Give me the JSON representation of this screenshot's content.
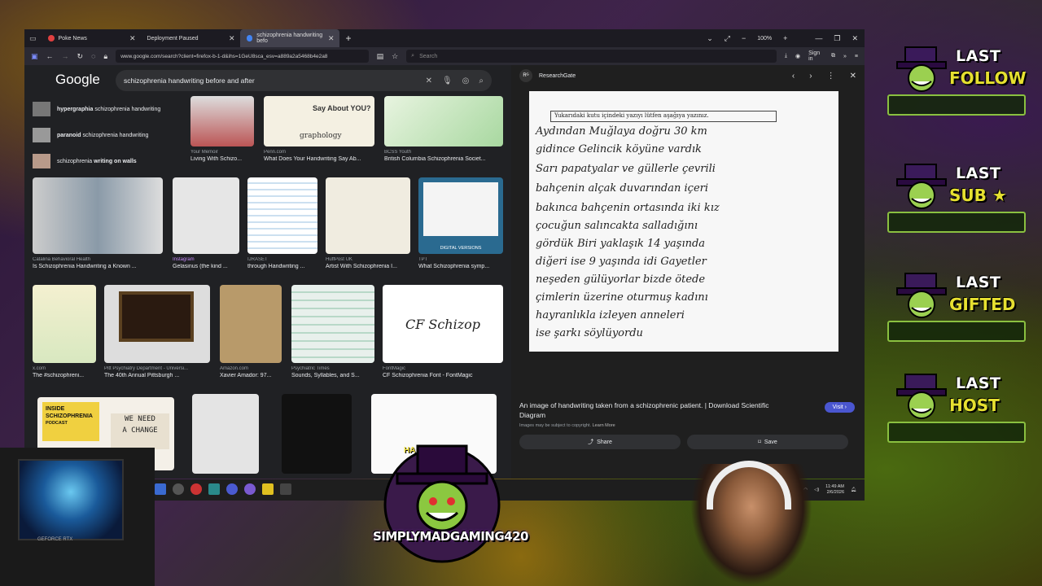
{
  "browser": {
    "tabs": [
      {
        "label": "Poke News",
        "active": false
      },
      {
        "label": "Deployment Paused",
        "active": false
      },
      {
        "label": "schizophrenia handwriting befo",
        "active": true
      }
    ],
    "zoom": "100%",
    "url": "www.google.com/search?client=firefox-b-1-d&ihs=1GeU8sca_esv=a889a2a5468b4e2a8",
    "search_placeholder": "Search",
    "sign_in": "Sign in"
  },
  "google": {
    "logo": "Google",
    "query": "schizophrenia handwriting before and after",
    "suggestions": [
      {
        "bold": "hypergraphia",
        "rest": "schizophrenia handwriting"
      },
      {
        "bold": "paranoid",
        "rest": "schizophrenia handwriting"
      },
      {
        "rest": "schizophrenia",
        "bold": "writing on walls"
      }
    ],
    "results_row1": [
      {
        "source": "Your Memoir",
        "title": "Living With Schizo..."
      },
      {
        "source": "Penn.com",
        "title": "What Does Your Handwriting Say Ab..."
      },
      {
        "source": "BCSS Youth",
        "title": "British Columbia Schizophrenia Societ..."
      }
    ],
    "results_row2": [
      {
        "source": "Catalina Behavioral Health",
        "title": "Is Schizophrenia Handwriting a Known ..."
      },
      {
        "source": "Instagram",
        "title": "Gelasinus (the kind ..."
      },
      {
        "source": "IJRASET",
        "title": "through Handwriting ..."
      },
      {
        "source": "HuffPost UK",
        "title": "Artist With Schizophrenia I..."
      },
      {
        "source": "TPT",
        "title": "What Schizophrenia symp..."
      }
    ],
    "results_row3": [
      {
        "source": "x.com",
        "title": "The #schizophreni..."
      },
      {
        "source": "Pitt Psychiatry Department - Universi...",
        "title": "The 40th Annual Pittsburgh ..."
      },
      {
        "source": "Amazon.com",
        "title": "Xavier Amador: 97..."
      },
      {
        "source": "Psychiatric Times",
        "title": "Sounds, Syllables, and S..."
      },
      {
        "source": "FontMagic",
        "title": "CF Schizophrenia Font - FontMagic"
      }
    ],
    "thumb_texts": {
      "cf_schizop": "CF Schizop",
      "graphology": "graphology",
      "handwriting_say": "Say About YOU?",
      "inside": "INSIDE",
      "schizophrenia": "SCHIZOPHRENIA",
      "podcast": "PODCAST",
      "we_need": "WE NEED",
      "a_change": "A CHANGE",
      "digital_versions": "DIGITAL VERSIONS"
    }
  },
  "preview": {
    "source": "ResearchGate",
    "rg_logo": "Rᴳ",
    "handwriting_lines": [
      "Yukarıdaki kutu içindeki yazıyı lütfen aşağıya yazınız.",
      "Aydından Muğlaya doğru 30 km",
      "gidince Gelincik köyüne vardık",
      "Sarı papatyalar ve güllerle çevrili",
      "bahçenin alçak duvarından içeri",
      "bakınca bahçenin ortasında iki kız",
      "çocuğun salıncakta salladığını",
      "gördük Biri yaklaşık 14 yaşında",
      "diğeri ise 9 yaşında idi Gayetler",
      "neşeden gülüyorlar bizde ötede",
      "çimlerin üzerine oturmuş kadını",
      "hayranlıkla izleyen anneleri",
      "ise şarkı söylüyordu"
    ],
    "title": "An image of handwriting taken from a schizophrenic patient. | Download Scientific Diagram",
    "visit": "Visit",
    "copyright": "Images may be subject to copyright.",
    "learn_more": "Learn More",
    "share": "Share",
    "save": "Save"
  },
  "taskbar": {
    "time": "11:49 AM",
    "date": "2/6/2026"
  },
  "overlay": {
    "alerts": [
      {
        "line1": "LAST",
        "line2": "FOLLOW"
      },
      {
        "line1": "LAST",
        "line2": "SUB ★"
      },
      {
        "line1": "LAST",
        "line2": "GIFTED"
      },
      {
        "line1": "LAST",
        "line2": "HOST"
      }
    ],
    "channel": "SIMPLYMADGAMING420",
    "badge_ha": "HA",
    "pc_label": "GEFORCE RTX"
  }
}
